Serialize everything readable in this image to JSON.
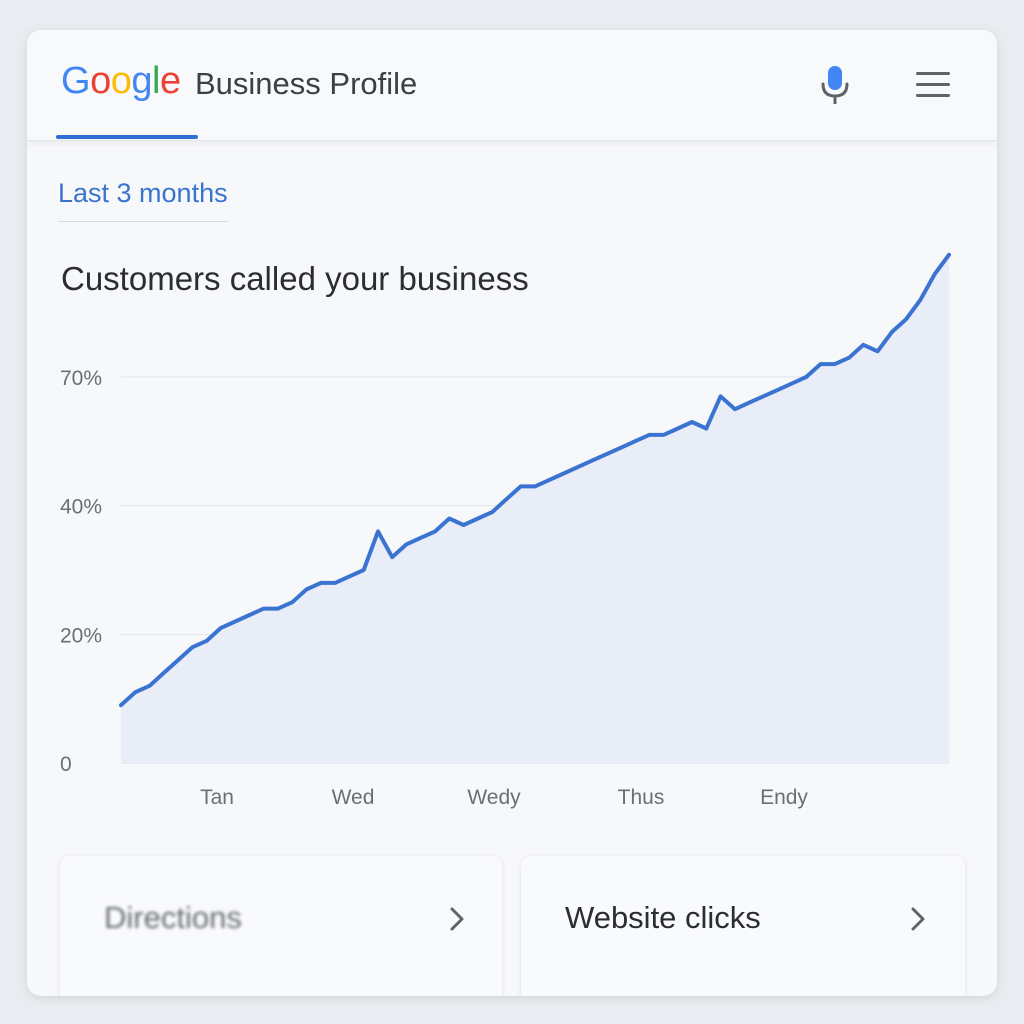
{
  "header": {
    "logo_letters": [
      {
        "char": "G",
        "color": "#4285F4"
      },
      {
        "char": "o",
        "color": "#EA4335"
      },
      {
        "char": "o",
        "color": "#FBBC05"
      },
      {
        "char": "g",
        "color": "#4285F4"
      },
      {
        "char": "l",
        "color": "#34A853"
      },
      {
        "char": "e",
        "color": "#EA4335"
      }
    ],
    "product_name": "Business Profile",
    "icons": [
      "mic-icon",
      "menu-icon"
    ]
  },
  "filter": {
    "range_label": "Last 3 months"
  },
  "chart_title": "Customers called your business",
  "chart_data": {
    "type": "area",
    "title": "Customers called your business",
    "y_tick_labels": [
      "0",
      "20%",
      "40%",
      "70%"
    ],
    "x_tick_labels": [
      "Tan",
      "Wed",
      "Wedy",
      "Thus",
      "Endy"
    ],
    "ylim": [
      0,
      80
    ],
    "grid": true,
    "line_color": "#3a73d1",
    "fill_color": "#e8edf8",
    "series": [
      {
        "values": [
          9,
          11,
          12,
          14,
          16,
          18,
          19,
          21,
          22,
          23,
          24,
          24,
          25,
          27,
          28,
          28,
          29,
          30,
          36,
          32,
          34,
          35,
          36,
          38,
          37,
          38,
          39,
          41,
          43,
          43,
          44,
          45,
          46,
          47,
          48,
          49,
          50,
          51,
          51,
          52,
          53,
          52,
          57,
          55,
          56,
          57,
          58,
          59,
          60,
          62,
          62,
          63,
          65,
          64,
          67,
          69,
          72,
          76,
          79
        ]
      }
    ]
  },
  "tiles": [
    {
      "label": "Directions"
    },
    {
      "label": "Website clicks"
    }
  ],
  "colors": {
    "accent": "#2f6fd6",
    "link": "#3a74cf",
    "text": "#2b2d30"
  }
}
